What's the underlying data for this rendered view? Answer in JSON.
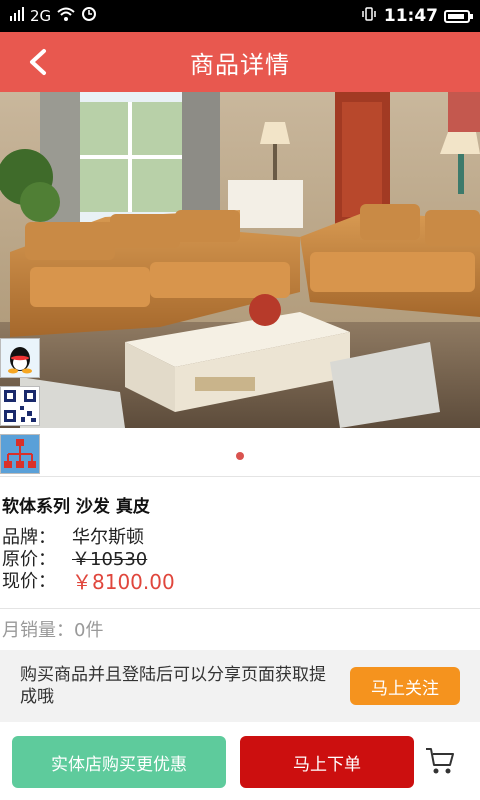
{
  "status_bar": {
    "network": "2G",
    "time": "11:47",
    "battery_level": 0.9
  },
  "header": {
    "title": "商品详情"
  },
  "carousel": {
    "active_index": 0,
    "count": 1
  },
  "product": {
    "name": "软体系列 沙发 真皮",
    "brand_label": "品牌：",
    "brand": "华尔斯顿",
    "original_price_label": "原价：",
    "original_price": "￥10530",
    "current_price_label": "现价：",
    "current_price": "￥8100.00",
    "monthly_sales": "月销量：0件"
  },
  "share": {
    "text": "购买商品并且登陆后可以分享页面获取提成哦",
    "follow_label": "马上关注"
  },
  "actions": {
    "store_label": "实体店购买更优惠",
    "order_label": "马上下单"
  },
  "colors": {
    "header_bg": "#e8584f",
    "follow_btn": "#f5931e",
    "store_btn": "#5ecb9c",
    "order_btn": "#cc0f0f",
    "price": "#e0463c"
  }
}
